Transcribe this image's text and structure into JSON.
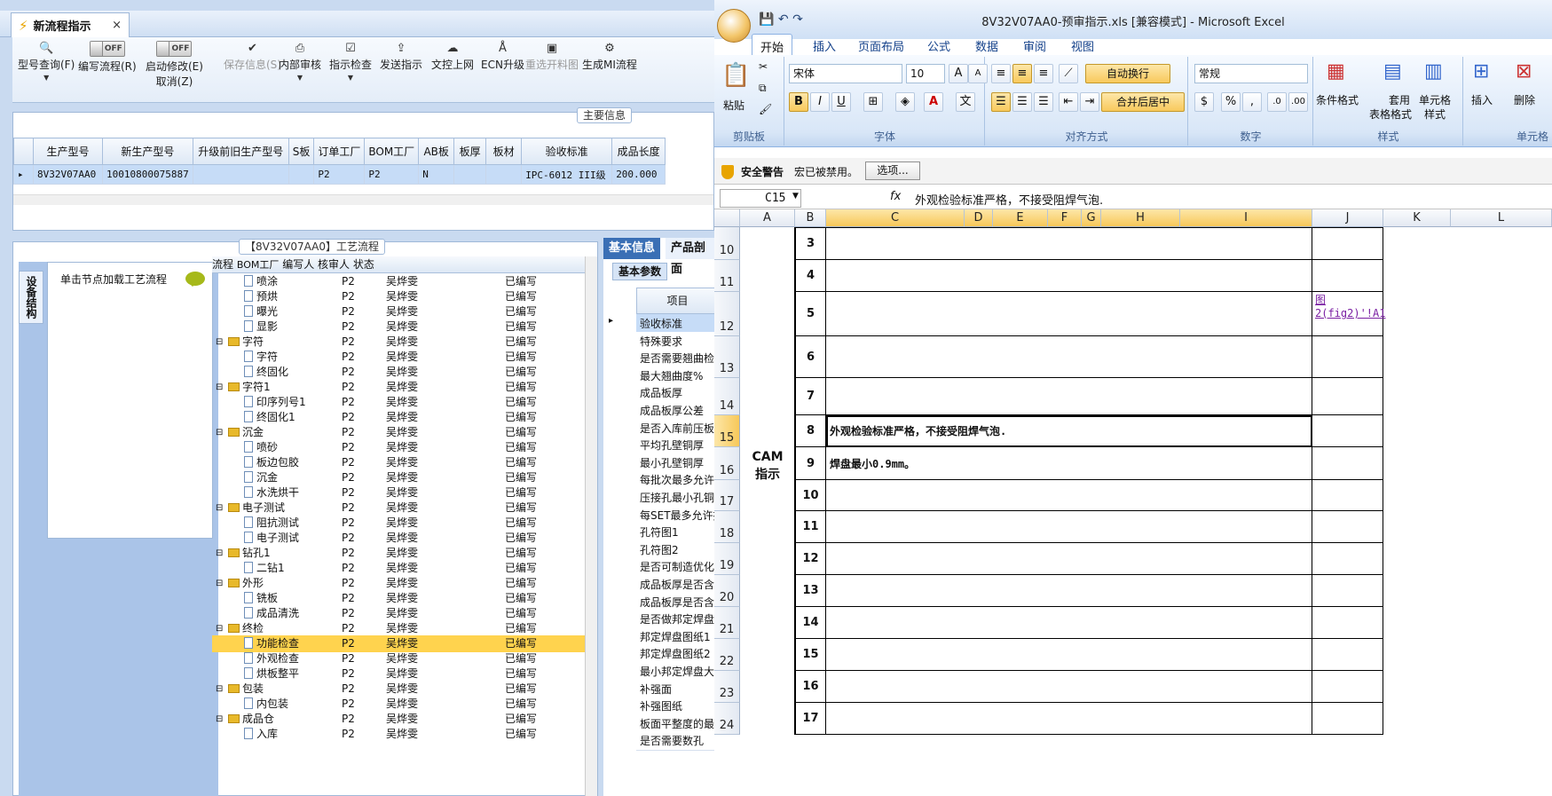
{
  "left_app": {
    "tab": {
      "title": "新流程指示",
      "close": "×"
    },
    "toolbar": {
      "model_query": "型号查询(F)",
      "write_flow": "编写流程(R)",
      "write_toggle": "OFF",
      "auto_modify": "启动修改(E)",
      "auto_toggle": "OFF",
      "cancel": "取消(Z)",
      "save": "保存信息(S)",
      "internal_review": "内部审核",
      "instruction_check": "指示检查",
      "send": "发送指示",
      "upload": "文控上网",
      "ecn": "ECN升级",
      "reopen": "重选开料图",
      "gen_mi": "生成MI流程"
    },
    "main_info": {
      "legend": "主要信息",
      "columns": [
        "生产型号",
        "新生产型号",
        "升级前旧生产型号",
        "S板",
        "订单工厂",
        "BOM工厂",
        "AB板",
        "板厚",
        "板材",
        "验收标准",
        "成品长度"
      ],
      "rows": [
        [
          "8V32V07AA0",
          "10010800075887",
          "",
          "",
          "P2",
          "P2",
          "N",
          "",
          "",
          "IPC-6012 III级",
          "200.000"
        ]
      ]
    },
    "process": {
      "legend": "【8V32V07AA0】工艺流程",
      "vertical_tab": "设备结构",
      "hint": "单击节点加载工艺流程",
      "columns": [
        "流程",
        "BOM工厂",
        "编写人",
        "核审人",
        "状态"
      ],
      "rows": [
        {
          "name": "喷涂",
          "type": "doc",
          "f": "P2",
          "w": "吴烨雯",
          "s": "已编写"
        },
        {
          "name": "预烘",
          "type": "doc",
          "f": "P2",
          "w": "吴烨雯",
          "s": "已编写"
        },
        {
          "name": "曝光",
          "type": "doc",
          "f": "P2",
          "w": "吴烨雯",
          "s": "已编写"
        },
        {
          "name": "显影",
          "type": "doc",
          "f": "P2",
          "w": "吴烨雯",
          "s": "已编写"
        },
        {
          "name": "字符",
          "type": "folder",
          "f": "P2",
          "w": "吴烨雯",
          "s": "已编写"
        },
        {
          "name": "字符",
          "type": "doc",
          "f": "P2",
          "w": "吴烨雯",
          "s": "已编写"
        },
        {
          "name": "终固化",
          "type": "doc",
          "f": "P2",
          "w": "吴烨雯",
          "s": "已编写"
        },
        {
          "name": "字符1",
          "type": "folder",
          "f": "P2",
          "w": "吴烨雯",
          "s": "已编写"
        },
        {
          "name": "印序列号1",
          "type": "doc",
          "f": "P2",
          "w": "吴烨雯",
          "s": "已编写"
        },
        {
          "name": "终固化1",
          "type": "doc",
          "f": "P2",
          "w": "吴烨雯",
          "s": "已编写"
        },
        {
          "name": "沉金",
          "type": "folder",
          "f": "P2",
          "w": "吴烨雯",
          "s": "已编写"
        },
        {
          "name": "喷砂",
          "type": "doc",
          "f": "P2",
          "w": "吴烨雯",
          "s": "已编写"
        },
        {
          "name": "板边包胶",
          "type": "doc",
          "f": "P2",
          "w": "吴烨雯",
          "s": "已编写"
        },
        {
          "name": "沉金",
          "type": "doc",
          "f": "P2",
          "w": "吴烨雯",
          "s": "已编写"
        },
        {
          "name": "水洗烘干",
          "type": "doc",
          "f": "P2",
          "w": "吴烨雯",
          "s": "已编写"
        },
        {
          "name": "电子测试",
          "type": "folder",
          "f": "P2",
          "w": "吴烨雯",
          "s": "已编写"
        },
        {
          "name": "阻抗测试",
          "type": "doc",
          "f": "P2",
          "w": "吴烨雯",
          "s": "已编写"
        },
        {
          "name": "电子测试",
          "type": "doc",
          "f": "P2",
          "w": "吴烨雯",
          "s": "已编写"
        },
        {
          "name": "钻孔1",
          "type": "folder",
          "f": "P2",
          "w": "吴烨雯",
          "s": "已编写"
        },
        {
          "name": "二钻1",
          "type": "doc",
          "f": "P2",
          "w": "吴烨雯",
          "s": "已编写"
        },
        {
          "name": "外形",
          "type": "folder",
          "f": "P2",
          "w": "吴烨雯",
          "s": "已编写"
        },
        {
          "name": "铣板",
          "type": "doc",
          "f": "P2",
          "w": "吴烨雯",
          "s": "已编写"
        },
        {
          "name": "成品清洗",
          "type": "doc",
          "f": "P2",
          "w": "吴烨雯",
          "s": "已编写"
        },
        {
          "name": "终检",
          "type": "folder",
          "f": "P2",
          "w": "吴烨雯",
          "s": "已编写"
        },
        {
          "name": "功能检查",
          "type": "doc",
          "f": "P2",
          "w": "吴烨雯",
          "s": "已编写",
          "selected": true
        },
        {
          "name": "外观检查",
          "type": "doc",
          "f": "P2",
          "w": "吴烨雯",
          "s": "已编写"
        },
        {
          "name": "烘板整平",
          "type": "doc",
          "f": "P2",
          "w": "吴烨雯",
          "s": "已编写"
        },
        {
          "name": "包装",
          "type": "folder",
          "f": "P2",
          "w": "吴烨雯",
          "s": "已编写"
        },
        {
          "name": "内包装",
          "type": "doc",
          "f": "P2",
          "w": "吴烨雯",
          "s": "已编写"
        },
        {
          "name": "成品仓",
          "type": "folder",
          "f": "P2",
          "w": "吴烨雯",
          "s": "已编写"
        },
        {
          "name": "入库",
          "type": "doc",
          "f": "P2",
          "w": "吴烨雯",
          "s": "已编写"
        }
      ]
    },
    "basic": {
      "tabs": [
        "基本信息",
        "产品剖面"
      ],
      "subtab": "基本参数",
      "col": "项目",
      "items": [
        "验收标准",
        "特殊要求",
        "是否需要翘曲检查",
        "最大翘曲度%",
        "成品板厚",
        "成品板厚公差",
        "是否入库前压板",
        "平均孔壁铜厚",
        "最小孔壁铜厚",
        "每批次最多允许",
        "压接孔最小孔铜",
        "每SET最多允许报",
        "孔符图1",
        "孔符图2",
        "是否可制造优化",
        "成品板厚是否含",
        "成品板厚是否含",
        "是否做邦定焊盘",
        "邦定焊盘图纸1",
        "邦定焊盘图纸2",
        "最小邦定焊盘大小",
        "补强面",
        "补强图纸",
        "板面平整度的最",
        "是否需要数孔"
      ]
    }
  },
  "excel": {
    "title": "8V32V07AA0-预审指示.xls  [兼容模式] - Microsoft Excel",
    "ribbon_tabs": [
      "开始",
      "插入",
      "页面布局",
      "公式",
      "数据",
      "审阅",
      "视图"
    ],
    "clipboard": {
      "paste": "粘贴",
      "label": "剪贴板"
    },
    "font": {
      "name": "宋体",
      "size": "10",
      "label": "字体"
    },
    "alignment": {
      "wrap": "自动换行",
      "merge": "合并后居中",
      "label": "对齐方式"
    },
    "number": {
      "format": "常规",
      "label": "数字"
    },
    "styles": {
      "cond": "条件格式",
      "table": "套用",
      "table2": "表格格式",
      "cell": "单元格",
      "cell2": "样式",
      "label": "样式"
    },
    "cells": {
      "insert": "插入",
      "delete": "删除",
      "label": "单元格"
    },
    "security": {
      "title": "安全警告",
      "msg": "宏已被禁用。",
      "options": "选项..."
    },
    "formula": {
      "cell_ref": "C15",
      "fx": "fx",
      "content": "外观检验标准严格，不接受阻焊气泡."
    },
    "columns": [
      "A",
      "B",
      "C",
      "D",
      "E",
      "F",
      "G",
      "H",
      "I",
      "J",
      "K",
      "L"
    ],
    "rows": [
      {
        "row": "10",
        "num": "3",
        "text": "",
        "j": ""
      },
      {
        "row": "11",
        "num": "4",
        "text": "",
        "j": ""
      },
      {
        "row": "12",
        "num": "5",
        "text": "",
        "j": "图2(fig2)'!A1"
      },
      {
        "row": "13",
        "num": "6",
        "text": "",
        "j": ""
      },
      {
        "row": "14",
        "num": "7",
        "text": "",
        "j": ""
      },
      {
        "row": "15",
        "num": "8",
        "text": "外观检验标准严格，不接受阻焊气泡.",
        "j": ""
      },
      {
        "row": "16",
        "num": "9",
        "text": "焊盘最小0.9mm。",
        "j": ""
      },
      {
        "row": "17",
        "num": "10",
        "text": "",
        "j": ""
      },
      {
        "row": "18",
        "num": "11",
        "text": "",
        "j": ""
      },
      {
        "row": "19",
        "num": "12",
        "text": "",
        "j": ""
      },
      {
        "row": "20",
        "num": "13",
        "text": "",
        "j": ""
      },
      {
        "row": "21",
        "num": "14",
        "text": "",
        "j": ""
      },
      {
        "row": "22",
        "num": "15",
        "text": "",
        "j": ""
      },
      {
        "row": "23",
        "num": "16",
        "text": "",
        "j": ""
      },
      {
        "row": "24",
        "num": "17",
        "text": "",
        "j": ""
      }
    ],
    "cam_label": "CAM指示"
  }
}
